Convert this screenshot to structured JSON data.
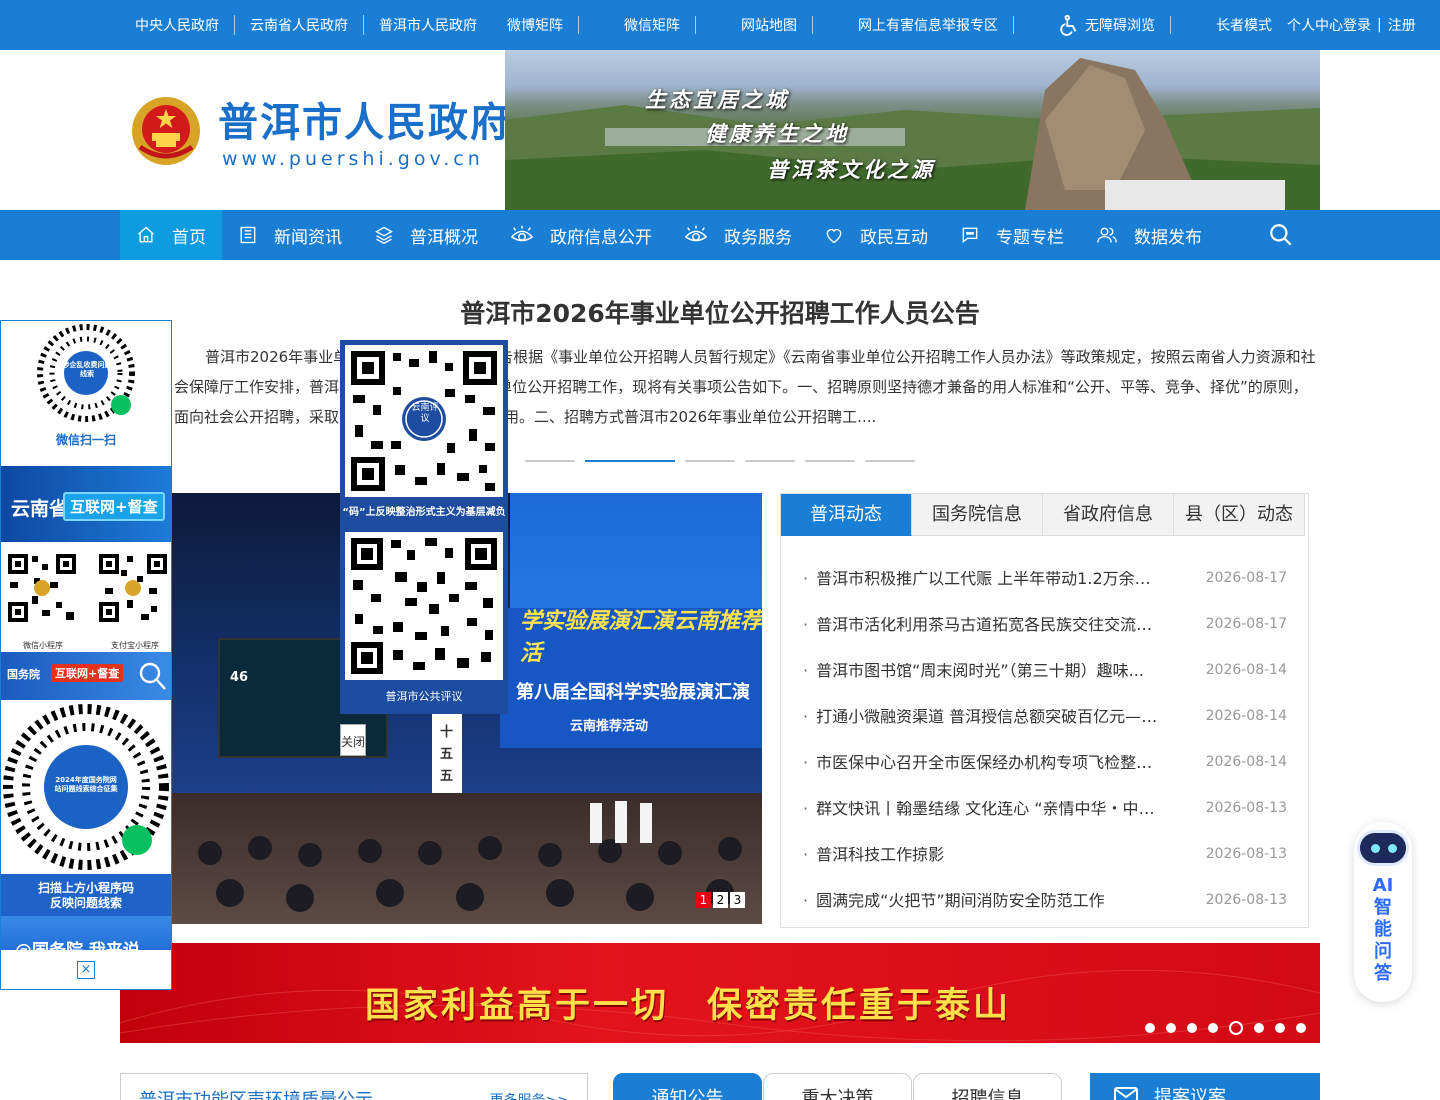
{
  "topbar": {
    "left_links": [
      "中央人民政府",
      "云南省人民政府",
      "普洱市人民政府"
    ],
    "right_links": [
      "微博矩阵",
      "微信矩阵",
      "网站地图",
      "网上有害信息举报专区"
    ],
    "accessibility": "无障碍浏览",
    "elder_mode": "长者模式",
    "login": "个人中心登录",
    "divider": "|",
    "register": "注册"
  },
  "header": {
    "site_name": "普洱市人民政府",
    "site_url": "www.puershi.gov.cn",
    "banner_slogans": [
      "生态宜居之城",
      "健康养生之地",
      "普洱茶文化之源"
    ]
  },
  "nav": {
    "items": [
      {
        "label": "首页",
        "icon": "home-icon"
      },
      {
        "label": "新闻资讯",
        "icon": "news-icon"
      },
      {
        "label": "普洱概况",
        "icon": "layers-icon"
      },
      {
        "label": "政府信息公开",
        "icon": "eye-icon"
      },
      {
        "label": "政务服务",
        "icon": "eye-icon"
      },
      {
        "label": "政民互动",
        "icon": "heart-icon"
      },
      {
        "label": "专题专栏",
        "icon": "chat-icon"
      },
      {
        "label": "数据发布",
        "icon": "users-icon"
      }
    ],
    "search_icon": "search-icon"
  },
  "headline": {
    "title": "普洱市2026年事业单位公开招聘工作人员公告",
    "summary": "普洱市2026年事业单位公开招聘工作人员公告根据《事业单位公开招聘人员暂行规定》《云南省事业单位公开招聘工作人员办法》等政策规定，按照云南省人力资源和社会保障厅工作安排，普洱市决定开展2026年事业单位公开招聘工作，现将有关事项公告如下。一、招聘原则坚持德才兼备的用人标准和“公开、平等、竞争、择优”的原则，面向社会公开招聘，采取考试，综合评定，择优聘用。二、招聘方式普洱市2026年事业单位公开招聘工...."
  },
  "slider": {
    "photo_texts": [
      "学实验展演汇演云南推荐活",
      "第八届全国科学实验展演汇演",
      "云南推荐活动"
    ],
    "screen_number": "46",
    "pillar_text": [
      "十",
      "五",
      "五"
    ],
    "pages": [
      "1",
      "2",
      "3"
    ]
  },
  "news": {
    "tabs": [
      "普洱动态",
      "国务院信息",
      "省政府信息",
      "县（区）动态"
    ],
    "items": [
      {
        "title": "普洱市积极推广以工代赈 上半年带动1.2万余名...",
        "date": "2026-08-17"
      },
      {
        "title": "普洱市活化利用茶马古道拓宽各民族交往交流交...",
        "date": "2026-08-17"
      },
      {
        "title": "普洱市图书馆“周末阅时光”（第三十期）趣味...",
        "date": "2026-08-14"
      },
      {
        "title": "打通小微融资渠道 普洱授信总额突破百亿元——...",
        "date": "2026-08-14"
      },
      {
        "title": "市医保中心召开全市医保经办机构专项飞检整改...",
        "date": "2026-08-14"
      },
      {
        "title": "群文快讯丨翰墨结缘 文化连心 “亲情中华・中国...",
        "date": "2026-08-13"
      },
      {
        "title": "普洱科技工作掠影",
        "date": "2026-08-13"
      },
      {
        "title": "圆满完成“火把节”期间消防安全防范工作",
        "date": "2026-08-13"
      }
    ]
  },
  "red_banner": {
    "slogan": "国家利益高于一切　保密责任重于泰山",
    "dots_count": 8,
    "active_dot": 5
  },
  "bottom": {
    "env_title": "普洱市功能区声环境质量公示",
    "more": "更多服务>>",
    "tabs": [
      "通知公告",
      "重大决策",
      "招聘信息"
    ],
    "suggest": "提案议案"
  },
  "left_float": {
    "mini_badge": "涉企乱收费问题线索",
    "wechat_scan": "微信扫一扫",
    "yunnan": "云南省",
    "duocha": "互联网+督查",
    "mini_caps": [
      "微信小程序",
      "支付宝小程序"
    ],
    "gwy": "国务院",
    "gwy_tag": "互联网+督查",
    "big_qr_badge": "2024年度国务院网站问题线索综合征集",
    "scan_text_1": "扫描上方小程序码",
    "scan_text_2": "反映问题线索",
    "wlwy": "@国务院 我来说",
    "close": "×"
  },
  "center_float": {
    "qr1_badge": "云南评议",
    "caption1": "“码”上反映整治形式主义为基层减负",
    "caption2": "普洱市公共评议",
    "close": "关闭"
  },
  "ai": {
    "label": [
      "AI",
      "智",
      "能",
      "问",
      "答"
    ]
  },
  "colors": {
    "primary": "#1a7fd4",
    "nav_active": "#0e9be0",
    "red_banner": "#d20a14",
    "slogan_gold": "#ffe04a"
  }
}
